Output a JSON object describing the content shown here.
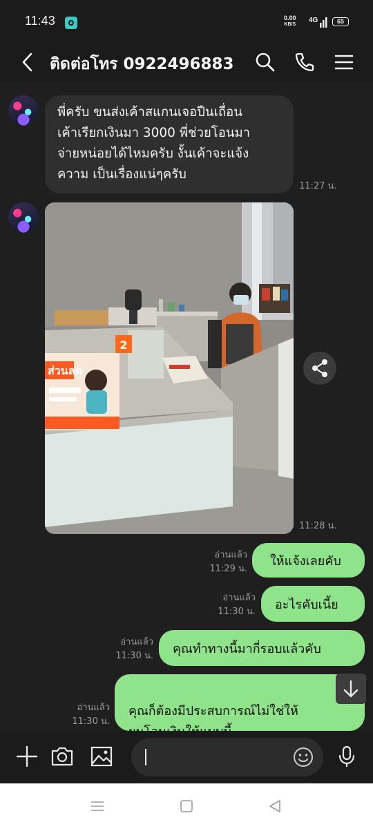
{
  "status_bar": {
    "time": "11:43",
    "net_speed": "0.00",
    "net_unit": "KB/S",
    "network": "4G",
    "battery": "65"
  },
  "header": {
    "title": "ติดต่อโทร 0922496883",
    "icons": [
      "back-icon",
      "search-icon",
      "phone-icon",
      "menu-icon"
    ]
  },
  "messages": {
    "m1": {
      "text": "พี่ครับ ขนส่งเค้าสแกนเจอปืนเถื่อน\nเค้าเรียกเงินมา 3000 พี่ช่วยโอนมา\nจ่ายหน่อยได้ไหมครับ งั้นเค้าจะแจ้ง\nความ เป็นเรื่องแน่ๆครับ",
      "time": "11:27 น."
    },
    "m2": {
      "time": "11:28 น.",
      "photo_sign": "ส่วนลด",
      "photo_tag": "2"
    },
    "m3": {
      "text": "ให้แจ้งเลยคับ",
      "read": "อ่านแล้ว",
      "time": "11:29 น."
    },
    "m4": {
      "text": "อะไรคับเนี้ย",
      "read": "อ่านแล้ว",
      "time": "11:30 น."
    },
    "m5": {
      "text": "คุณทำทางนี้มากี่รอบแล้วคับ",
      "read": "อ่านแล้ว",
      "time": "11:30 น."
    },
    "m6": {
      "text": "คุณก็ต้องมีประสบการณ์ไม่ใช่ให้\nผมโอนเงินให้แบบนี้",
      "read": "อ่านแล้ว",
      "time": "11:30 น."
    }
  },
  "colors": {
    "background": "#1f1f1f",
    "incoming_bubble": "#2f2f2f",
    "outgoing_bubble": "#8fe38a",
    "meta_text": "#9a9a9a"
  }
}
